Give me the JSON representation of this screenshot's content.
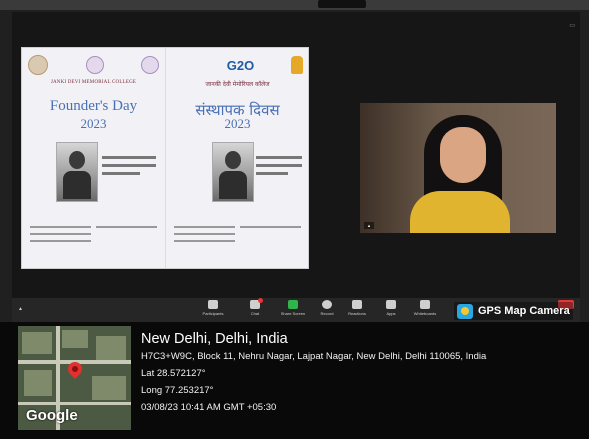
{
  "presentation": {
    "left_panel": {
      "college_name": "JANKI DEVI MEMORIAL COLLEGE",
      "title": "Founder's Day",
      "year": "2023"
    },
    "right_panel": {
      "logo_text": "G2O",
      "college_name": "जानकी देवी मेमोरियल कॉलेज",
      "title": "संस्थापक दिवस",
      "year": "2023"
    }
  },
  "toolbar": {
    "participants_label": "Participants",
    "chat_label": "Chat",
    "share_label": "Share Screen",
    "record_label": "Record",
    "reactions_label": "Reactions",
    "apps_label": "Apps",
    "whiteboards_label": "Whiteboards"
  },
  "gps_overlay": {
    "badge_text": "GPS Map Camera",
    "map_attribution": "Google",
    "location_title": "New Delhi, Delhi, India",
    "address": "H7C3+W9C, Block 11, Nehru Nagar, Lajpat Nagar, New Delhi, Delhi 110065, India",
    "latitude": "Lat 28.572127°",
    "longitude": "Long 77.253217°",
    "datetime": "03/08/23 10:41 AM GMT +05:30"
  }
}
